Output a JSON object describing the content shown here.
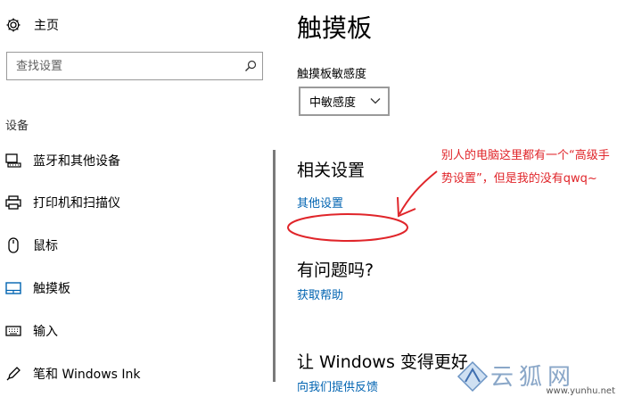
{
  "sidebar": {
    "home_label": "主页",
    "search_placeholder": "查找设置",
    "section_label": "设备",
    "items": [
      {
        "label": "蓝牙和其他设备",
        "icon": "bluetooth-devices-icon"
      },
      {
        "label": "打印机和扫描仪",
        "icon": "printer-icon"
      },
      {
        "label": "鼠标",
        "icon": "mouse-icon"
      },
      {
        "label": "触摸板",
        "icon": "touchpad-icon",
        "active": true
      },
      {
        "label": "输入",
        "icon": "keyboard-icon"
      },
      {
        "label": "笔和 Windows Ink",
        "icon": "pen-icon"
      }
    ]
  },
  "main": {
    "title": "触摸板",
    "sensitivity_label": "触摸板敏感度",
    "sensitivity_value": "中敏感度",
    "related_heading": "相关设置",
    "related_link": "其他设置",
    "question_heading": "有问题吗?",
    "help_link": "获取帮助",
    "improve_heading": "让 Windows 变得更好",
    "feedback_link": "向我们提供反馈"
  },
  "annotation": {
    "text": "别人的电脑这里都有一个“高级手势设置”，但是我的没有qwq~",
    "color": "#e0252a"
  },
  "watermark": {
    "text": "云狐网",
    "url": "www.yunhu.net"
  },
  "colors": {
    "accent": "#0063b1",
    "annotation": "#e0252a"
  }
}
